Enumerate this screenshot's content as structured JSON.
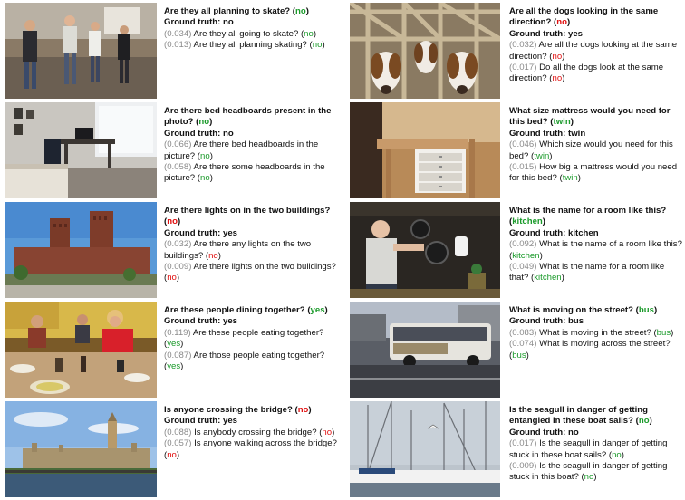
{
  "colors": {
    "correct": "#1a9a2a",
    "wrong": "#e01010",
    "score": "#8a8a8a"
  },
  "examples": [
    {
      "question": "Are they all planning to skate?",
      "prediction": "no",
      "prediction_color": "green",
      "ground_truth": "Ground truth: no",
      "paraphrases": [
        {
          "score": "(0.034)",
          "text": "Are they all going to skate?",
          "answer": "no",
          "answer_color": "green"
        },
        {
          "score": "(0.013)",
          "text": "Are they all planning skating?",
          "answer": "no",
          "answer_color": "green"
        }
      ]
    },
    {
      "question": "Are there bed headboards present in the photo?",
      "prediction": "no",
      "prediction_color": "green",
      "ground_truth": "Ground truth: no",
      "paraphrases": [
        {
          "score": "(0.066)",
          "text": "Are there bed headboards in the picture?",
          "answer": "no",
          "answer_color": "green"
        },
        {
          "score": "(0.058)",
          "text": "Are there some headboards in the picture?",
          "answer": "no",
          "answer_color": "green"
        }
      ]
    },
    {
      "question": "Are there lights on in the two buildings?",
      "prediction": "no",
      "prediction_color": "red",
      "ground_truth": "Ground truth: yes",
      "paraphrases": [
        {
          "score": "(0.032)",
          "text": "Are there any lights on the two buildings?",
          "answer": "no",
          "answer_color": "red"
        },
        {
          "score": "(0.009)",
          "text": "Are there lights on the two buildings?",
          "answer": "no",
          "answer_color": "red"
        }
      ]
    },
    {
      "question": "Are these people dining together?",
      "prediction": "yes",
      "prediction_color": "green",
      "ground_truth": "Ground truth: yes",
      "paraphrases": [
        {
          "score": "(0.119)",
          "text": "Are these people eating together?",
          "answer": "yes",
          "answer_color": "green"
        },
        {
          "score": "(0.087)",
          "text": "Are those people eating together?",
          "answer": "yes",
          "answer_color": "green"
        }
      ]
    },
    {
      "question": "Is anyone crossing the bridge?",
      "prediction": "no",
      "prediction_color": "red",
      "ground_truth": "Ground truth: yes",
      "paraphrases": [
        {
          "score": "(0.088)",
          "text": "Is anybody crossing the bridge?",
          "answer": "no",
          "answer_color": "red"
        },
        {
          "score": "(0.057)",
          "text": "Is anyone walking across the bridge?",
          "answer": "no",
          "answer_color": "red"
        }
      ]
    },
    {
      "question": "Are all the dogs looking in the same direction?",
      "prediction": "no",
      "prediction_color": "red",
      "ground_truth": "Ground truth: yes",
      "paraphrases": [
        {
          "score": "(0.032)",
          "text": "Are all the dogs looking at the same direction?",
          "answer": "no",
          "answer_color": "red"
        },
        {
          "score": "(0.017)",
          "text": "Do all the dogs look at the same direction?",
          "answer": "no",
          "answer_color": "red"
        }
      ]
    },
    {
      "question": "What size mattress would you need for this bed?",
      "prediction": "twin",
      "prediction_color": "green",
      "ground_truth": "Ground truth: twin",
      "paraphrases": [
        {
          "score": "(0.046)",
          "text": "Which size would you need for this bed?",
          "answer": "twin",
          "answer_color": "green"
        },
        {
          "score": "(0.015)",
          "text": "How big a mattress would you need for this bed?",
          "answer": "twin",
          "answer_color": "green"
        }
      ]
    },
    {
      "question": "What is the name for a room like this?",
      "prediction": "kitchen",
      "prediction_color": "green",
      "ground_truth": "Ground truth: kitchen",
      "paraphrases": [
        {
          "score": "(0.092)",
          "text": "What is the name of a room like this?",
          "answer": "kitchen",
          "answer_color": "green"
        },
        {
          "score": "(0.049)",
          "text": "What is the name for a room like that?",
          "answer": "kitchen",
          "answer_color": "green"
        }
      ]
    },
    {
      "question": "What is moving on the street?",
      "prediction": "bus",
      "prediction_color": "green",
      "ground_truth": "Ground truth: bus",
      "paraphrases": [
        {
          "score": "(0.083)",
          "text": "What is moving in the street?",
          "answer": "bus",
          "answer_color": "green"
        },
        {
          "score": "(0.074)",
          "text": "What is moving across the street?",
          "answer": "bus",
          "answer_color": "green"
        }
      ]
    },
    {
      "question": "Is the seagull in danger of getting entangled in these boat sails?",
      "prediction": "no",
      "prediction_color": "green",
      "ground_truth": "Ground truth: no",
      "paraphrases": [
        {
          "score": "(0.017)",
          "text": "Is the seagull in danger of getting stuck in these boat sails?",
          "answer": "no",
          "answer_color": "green"
        },
        {
          "score": "(0.009)",
          "text": "Is the seagull in danger of getting stuck in this boat?",
          "answer": "no",
          "answer_color": "green"
        }
      ]
    }
  ]
}
